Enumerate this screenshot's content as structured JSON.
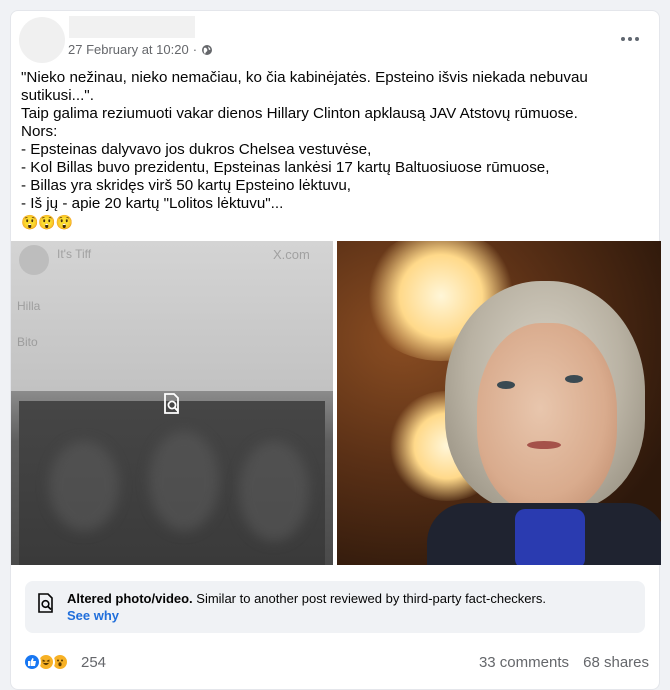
{
  "post": {
    "timestamp": "27 February at 10:20",
    "separator": "·",
    "privacy_icon": "globe-icon",
    "more_icon": "more-options-icon",
    "text_lines": [
      "\"Nieko nežinau, nieko nemačiau, ko čia kabinėjatės. Epsteino išvis niekada nebuvau sutikusi...\".",
      "Taip galima reziumuoti vakar dienos Hillary Clinton apklausą JAV Atstovų rūmuose.",
      "Nors:",
      "- Epsteinas dalyvavo jos dukros Chelsea vestuvėse,",
      "- Kol Billas buvo prezidentu, Epsteinas lankėsi 17 kartų Baltuosiuose rūmuose,",
      "- Billas yra skridęs virš 50 kartų Epsteino lėktuvu,",
      "- Iš jų - apie 20 kartų \"Lolitos lėktuvu\"..."
    ],
    "emoji_line": "😲😲😲"
  },
  "media": {
    "left_blurred_texts": [
      "It's Tiff",
      "X.com",
      "Hilla",
      "Bito"
    ],
    "left_overlay_icon": "altered-media-search-icon",
    "right_description_icon": "photo"
  },
  "fact_check": {
    "icon": "altered-media-search-icon",
    "title": "Altered photo/video.",
    "body": " Similar to another post reviewed by third-party fact-checkers.",
    "link": "See why"
  },
  "footer": {
    "reaction_icons": [
      "like-icon",
      "haha-icon",
      "wow-icon"
    ],
    "reaction_count": "254",
    "comments": "33 comments",
    "shares": "68 shares"
  },
  "colors": {
    "link": "#216fdb",
    "muted": "#65676b",
    "like": "#1877f2",
    "emoji": "#f7b125"
  }
}
